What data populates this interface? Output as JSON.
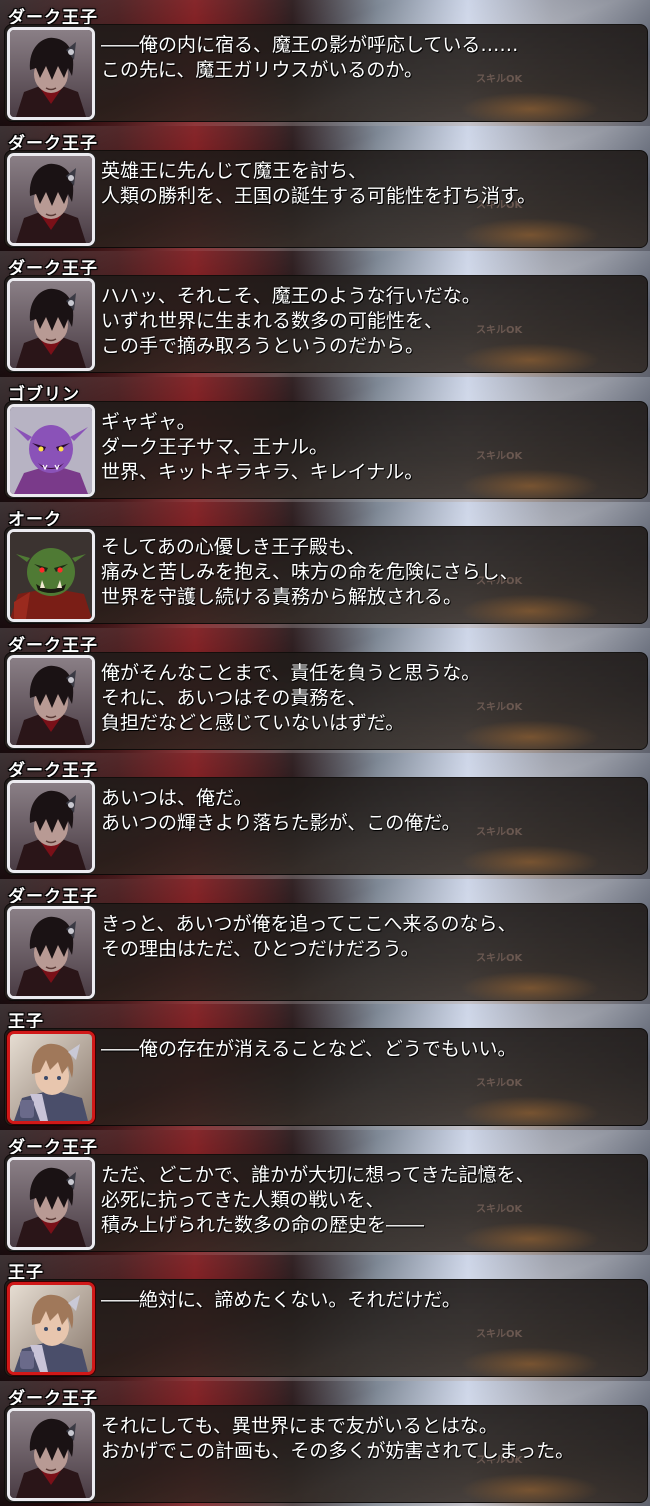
{
  "skill_label": "スキルOK",
  "entries": [
    {
      "speaker": "ダーク王子",
      "portrait_icon": "dark-prince-portrait-icon",
      "lines": [
        "――俺の内に宿る、魔王の影が呼応している……",
        "この先に、魔王ガリウスがいるのか。"
      ]
    },
    {
      "speaker": "ダーク王子",
      "portrait_icon": "dark-prince-portrait-icon",
      "lines": [
        "英雄王に先んじて魔王を討ち、",
        "人類の勝利を、王国の誕生する可能性を打ち消す。"
      ]
    },
    {
      "speaker": "ダーク王子",
      "portrait_icon": "dark-prince-portrait-icon",
      "lines": [
        "ハハッ、それこそ、魔王のような行いだな。",
        "いずれ世界に生まれる数多の可能性を、",
        "この手で摘み取ろうというのだから。"
      ]
    },
    {
      "speaker": "ゴブリン",
      "portrait_icon": "goblin-portrait-icon",
      "lines": [
        "ギャギャ。",
        "ダーク王子サマ、王ナル。",
        "世界、キットキラキラ、キレイナル。"
      ]
    },
    {
      "speaker": "オーク",
      "portrait_icon": "orc-portrait-icon",
      "lines": [
        "そしてあの心優しき王子殿も、",
        "痛みと苦しみを抱え、味方の命を危険にさらし、",
        "世界を守護し続ける責務から解放される。"
      ]
    },
    {
      "speaker": "ダーク王子",
      "portrait_icon": "dark-prince-portrait-icon",
      "lines": [
        "俺がそんなことまで、責任を負うと思うな。",
        "それに、あいつはその責務を、",
        "負担だなどと感じていないはずだ。"
      ]
    },
    {
      "speaker": "ダーク王子",
      "portrait_icon": "dark-prince-portrait-icon",
      "lines": [
        "あいつは、俺だ。",
        "あいつの輝きより落ちた影が、この俺だ。"
      ]
    },
    {
      "speaker": "ダーク王子",
      "portrait_icon": "dark-prince-portrait-icon",
      "lines": [
        "きっと、あいつが俺を追ってここへ来るのなら、",
        "その理由はただ、ひとつだけだろう。"
      ]
    },
    {
      "speaker": "王子",
      "portrait_icon": "prince-portrait-icon",
      "lines": [
        "――俺の存在が消えることなど、どうでもいい。"
      ]
    },
    {
      "speaker": "ダーク王子",
      "portrait_icon": "dark-prince-portrait-icon",
      "lines": [
        "ただ、どこかで、誰かが大切に想ってきた記憶を、",
        "必死に抗ってきた人類の戦いを、",
        "積み上げられた数多の命の歴史を――"
      ]
    },
    {
      "speaker": "王子",
      "portrait_icon": "prince-portrait-icon",
      "lines": [
        "――絶対に、諦めたくない。それだけだ。"
      ]
    },
    {
      "speaker": "ダーク王子",
      "portrait_icon": "dark-prince-portrait-icon",
      "lines": [
        "それにしても、異世界にまで友がいるとはな。",
        "おかげでこの計画も、その多くが妨害されてしまった。"
      ]
    }
  ]
}
